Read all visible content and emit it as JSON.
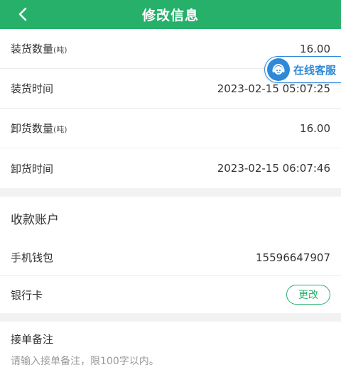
{
  "header": {
    "title": "修改信息"
  },
  "load": {
    "quantity_label": "装货数量",
    "quantity_unit": "(吨)",
    "quantity_value": "16.00",
    "time_label": "装货时间",
    "time_value": "2023-02-15 05:07:25"
  },
  "unload": {
    "quantity_label": "卸货数量",
    "quantity_unit": "(吨)",
    "quantity_value": "16.00",
    "time_label": "卸货时间",
    "time_value": "2023-02-15 06:07:46"
  },
  "payment": {
    "title": "收款账户",
    "wallet_label": "手机钱包",
    "wallet_value": "15596647907",
    "bank_label": "银行卡",
    "change_label": "更改"
  },
  "remark": {
    "label": "接单备注",
    "placeholder": "请输入接单备注，限100字以内。"
  },
  "service": {
    "label": "在线客服"
  },
  "colors": {
    "accent": "#26b06a",
    "service": "#2f88d8"
  }
}
